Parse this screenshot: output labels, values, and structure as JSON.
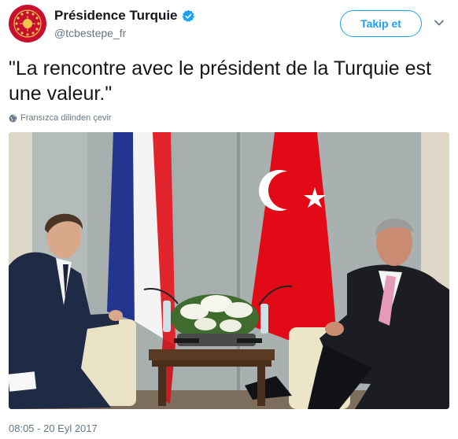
{
  "account": {
    "display_name": "Présidence Turquie",
    "handle": "@tcbestepe_fr",
    "verified": true
  },
  "follow_button": {
    "label": "Takip et"
  },
  "tweet": {
    "text": "\"La rencontre avec le président de la Turquie est une valeur.\"",
    "translate_label": "Fransızca dilinden çevir",
    "timestamp": "08:05 - 20 Eyl 2017"
  },
  "colors": {
    "accent": "#1da1f2",
    "secondary_text": "#657786",
    "turkish_red": "#e30a17",
    "french_blue": "#1f3f9a",
    "avatar_gold": "#d4a23a"
  },
  "icons": {
    "verified": "verified-badge-icon",
    "caret": "chevron-down-icon",
    "globe": "globe-icon"
  }
}
